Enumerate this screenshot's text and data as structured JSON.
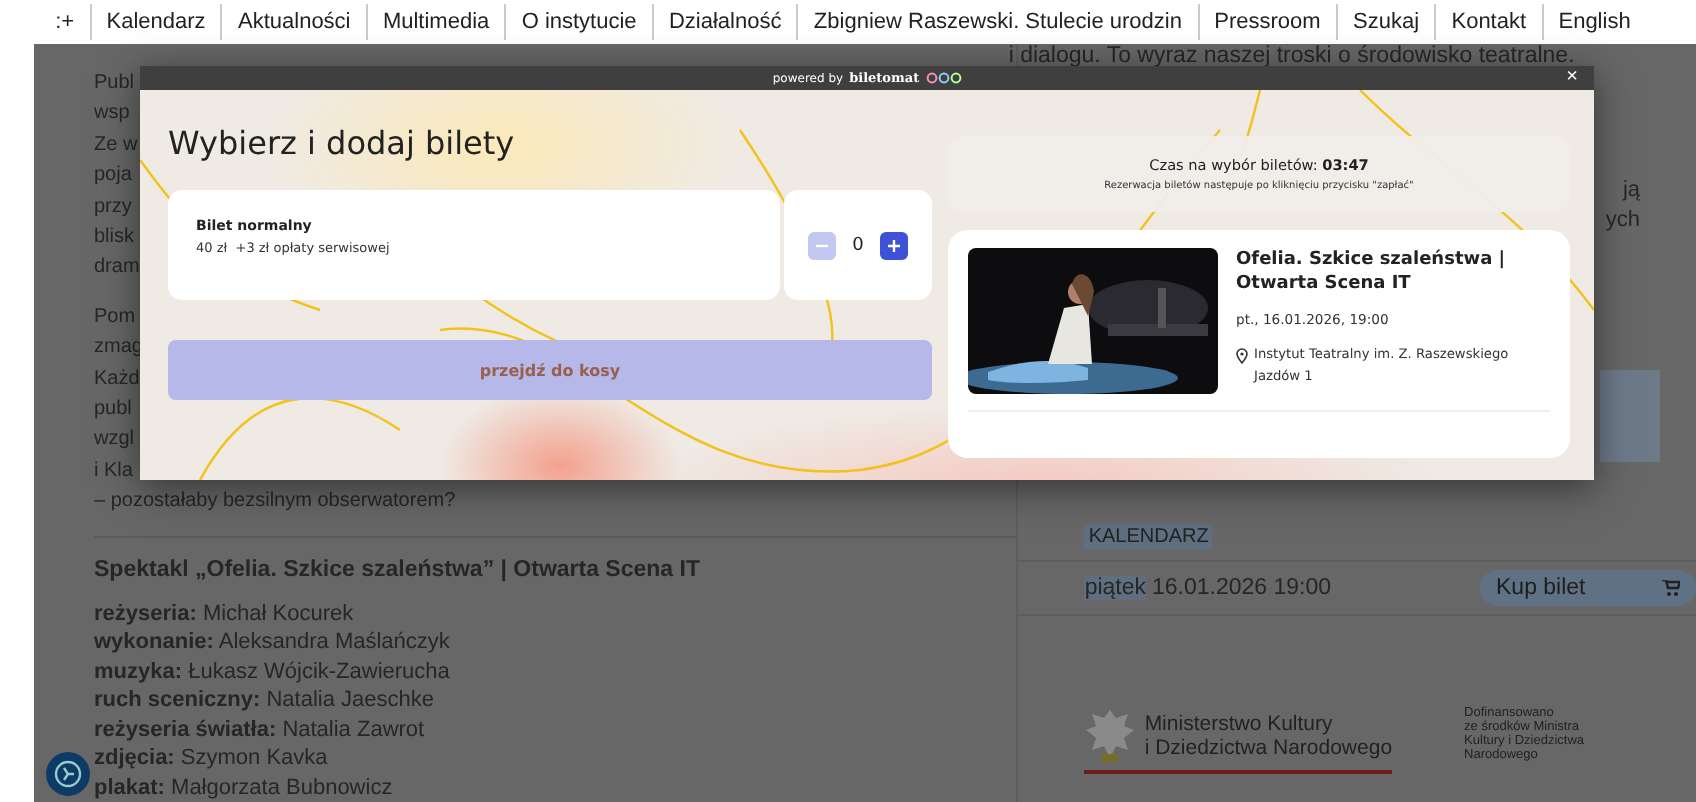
{
  "nav": {
    "menu_glyph": ":+",
    "items": [
      "Kalendarz",
      "Aktualności",
      "Multimedia",
      "O instytucie",
      "Działalność",
      "Zbigniew Raszewski. Stulecie urodzin",
      "Pressroom",
      "Szukaj",
      "Kontakt",
      "English"
    ]
  },
  "article": {
    "paragraphs": [
      [
        "Publ",
        "wsp",
        "Ze w",
        "poja",
        "przy",
        "blisk",
        "dram"
      ],
      [
        "Pom",
        "zmag",
        "Każd",
        "publ",
        "wzgl",
        "i Kla",
        "– pozostałaby bezsilnym obserwatorem?"
      ]
    ],
    "heading": "Spektakl „Ofelia. Szkice szaleństwa” | Otwarta Scena IT",
    "credits": [
      {
        "role": "reżyseria:",
        "name": "Michał Kocurek"
      },
      {
        "role": "wykonanie:",
        "name": "Aleksandra Maślańczyk"
      },
      {
        "role": "muzyka:",
        "name": "Łukasz Wójcik-Zawierucha"
      },
      {
        "role": "ruch sceniczny:",
        "name": "Natalia Jaeschke"
      },
      {
        "role": "reżyseria światła:",
        "name": "Natalia Zawrot"
      },
      {
        "role": "zdjęcia:",
        "name": "Szymon Kavka"
      },
      {
        "role": "plakat:",
        "name": "Małgorzata Bubnowicz"
      }
    ]
  },
  "sidebar": {
    "top_line": "i dialogu. To wyraz naszej troski o środowisko teatralne.",
    "fragments": [
      "ją",
      "ych"
    ],
    "tag": "KALENDARZ",
    "event_row": {
      "day": "piątek",
      "datetime": "16.01.2026  19:00",
      "buy_button": "Kup bilet"
    },
    "sponsor": {
      "ministry": [
        "Ministerstwo Kultury",
        "i Dziedzictwa Narodowego"
      ],
      "note": [
        "Dofinansowano",
        "ze środków Ministra",
        "Kultury i Dziedzictwa",
        "Narodowego"
      ]
    }
  },
  "modal": {
    "powered_by": "powered by",
    "brand": "biletomat",
    "close": "×",
    "title": "Wybierz i dodaj bilety",
    "ticket": {
      "name": "Bilet normalny",
      "price": "40 zł",
      "fee": "+3 zł opłaty serwisowej",
      "quantity": "0",
      "minus_disabled": true,
      "plus_disabled": false
    },
    "proceed_button": {
      "label": "przejdź do kosy",
      "disabled": true
    },
    "timer": {
      "text": "Czas na wybór biletów: **03:47**",
      "note": "Rezerwacja biletów następuje po kliknięciu przycisku \"zapłać\""
    },
    "event": {
      "title": "Ofelia. Szkice szaleństwa | Otwarta Scena IT",
      "date": "pt., 16.01.2026, 19:00",
      "location": [
        "Instytut Teatralny im. Z. Raszewskiego",
        "Jazdów 1"
      ]
    }
  }
}
